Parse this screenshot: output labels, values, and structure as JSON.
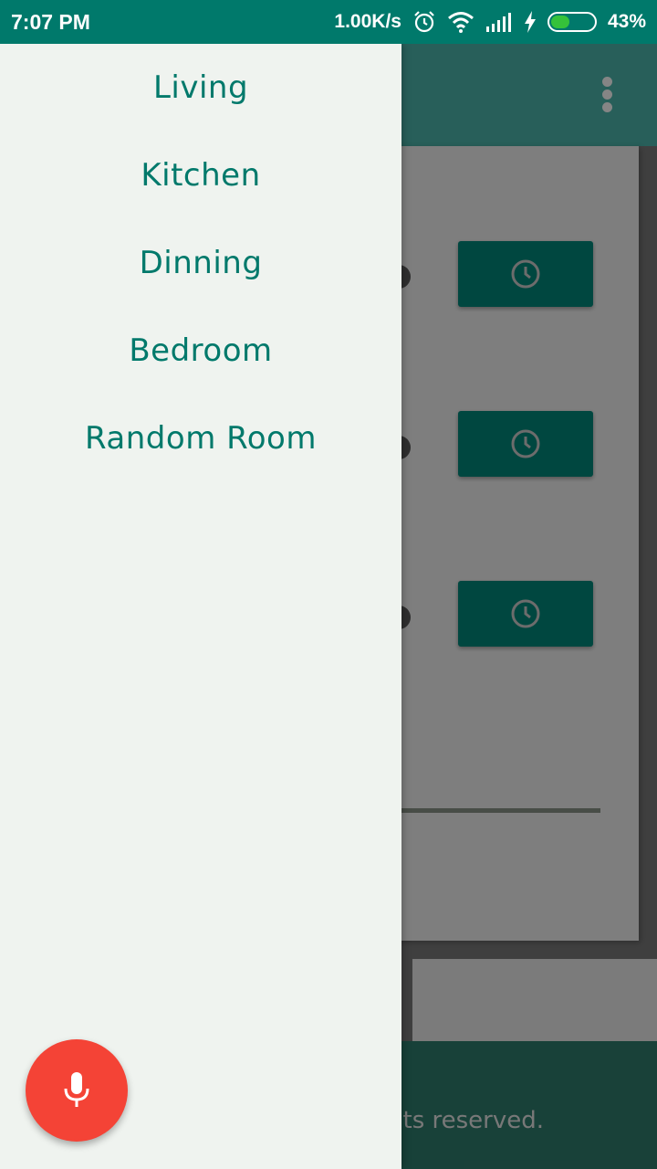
{
  "status_bar": {
    "time": "7:07 PM",
    "network_speed": "1.00K/s",
    "battery_percent": "43%",
    "battery_level": 0.43,
    "icons": [
      "alarm-icon",
      "wifi-icon",
      "signal-icon",
      "charging-icon",
      "battery-icon"
    ]
  },
  "app_bar": {
    "menu_icon": "overflow-menu-icon"
  },
  "drawer": {
    "items": [
      {
        "label": "Living"
      },
      {
        "label": "Kitchen"
      },
      {
        "label": "Dinning"
      },
      {
        "label": "Bedroom"
      },
      {
        "label": "Random Room"
      }
    ],
    "fab_icon": "microphone-icon"
  },
  "content": {
    "timer_buttons": [
      {
        "icon": "clock-icon"
      },
      {
        "icon": "clock-icon"
      },
      {
        "icon": "clock-icon"
      }
    ]
  },
  "footer": {
    "text": "nts reserved."
  },
  "colors": {
    "status_bar": "#00796b",
    "app_bar": "#4db6ac",
    "accent": "#00897b",
    "drawer_text": "#00796b",
    "drawer_bg": "#eff3ef",
    "fab": "#f44336"
  }
}
